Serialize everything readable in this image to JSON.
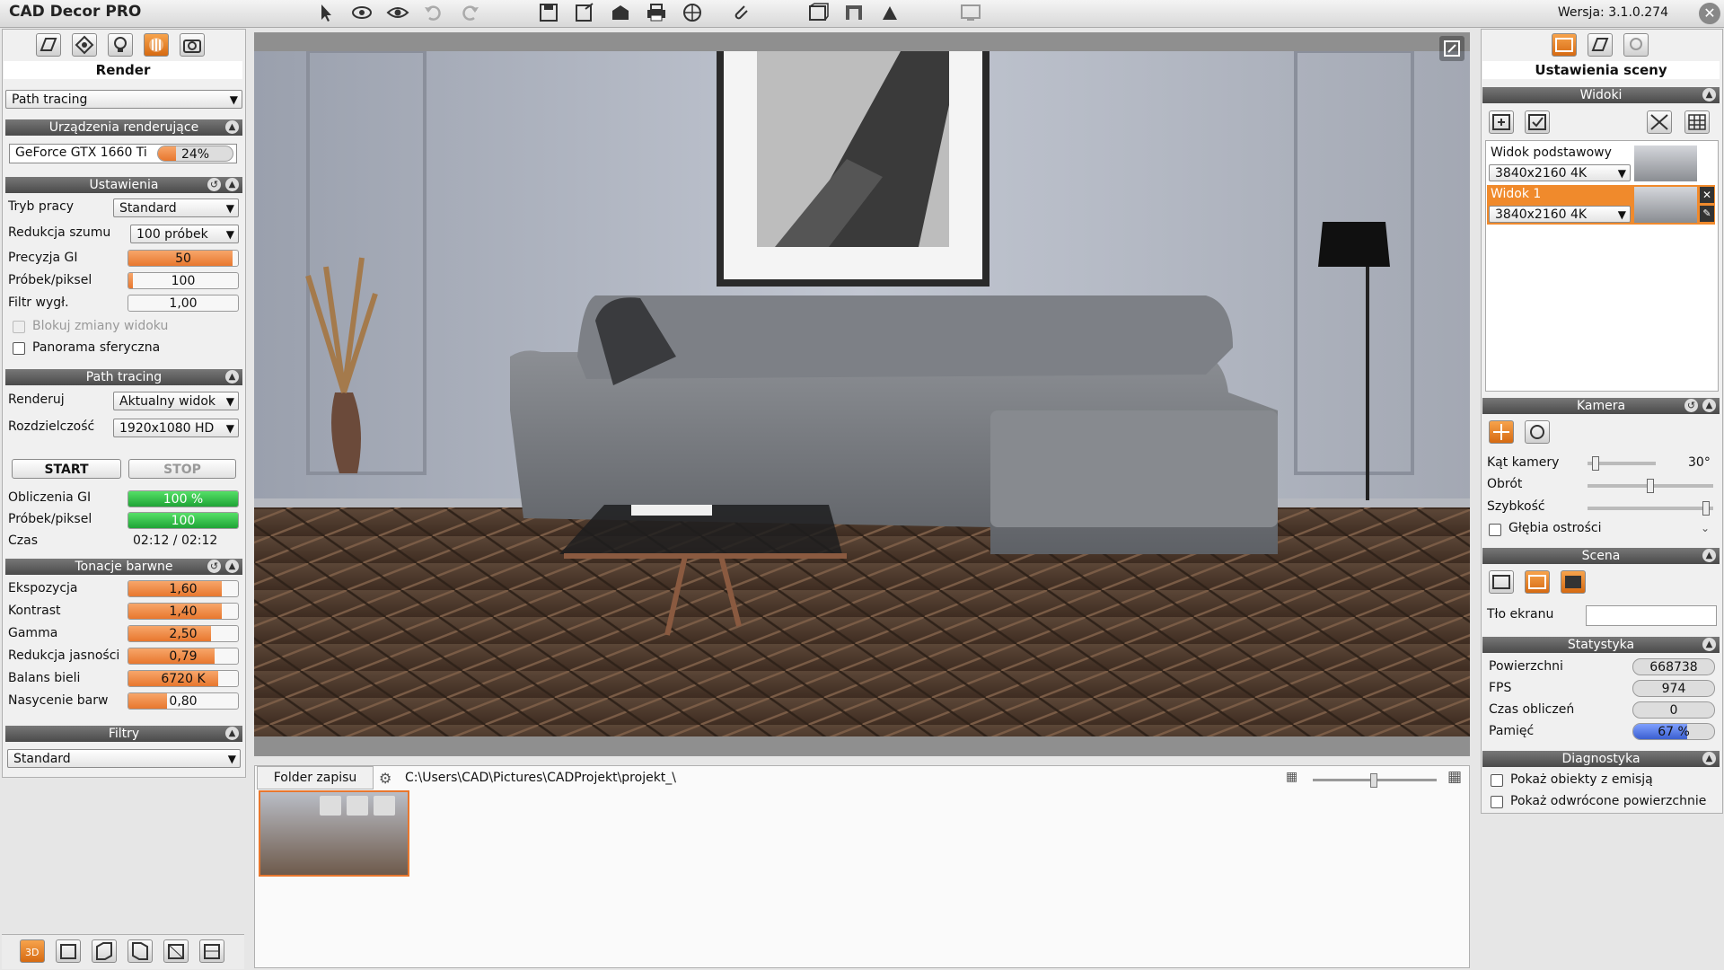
{
  "app": {
    "title": "CAD Decor PRO",
    "version": "Wersja: 3.1.0.274"
  },
  "left": {
    "header": "Render",
    "mode_select": "Path tracing",
    "devices": {
      "title": "Urządzenia renderujące",
      "gpu": "GeForce GTX 1660 Ti",
      "gpu_load": "24%",
      "gpu_load_value": 0.24
    },
    "settings": {
      "title": "Ustawienia",
      "work_mode_label": "Tryb pracy",
      "work_mode": "Standard",
      "denoise_label": "Redukcja szumu",
      "denoise": "100 próbek",
      "gi_label": "Precyzja GI",
      "gi": "50",
      "gi_fill": 0.95,
      "spp_label": "Próbek/piksel",
      "spp": "100",
      "spp_fill": 0.04,
      "filter_label": "Filtr wygł.",
      "filter": "1,00",
      "lock_label": "Blokuj zmiany widoku",
      "panorama_label": "Panorama sferyczna"
    },
    "pathtracing": {
      "title": "Path tracing",
      "render_label": "Renderuj",
      "render": "Aktualny widok",
      "res_label": "Rozdzielczość",
      "res": "1920x1080 HD",
      "start": "START",
      "stop": "STOP",
      "gi_calc_label": "Obliczenia GI",
      "gi_calc": "100 %",
      "spp_label": "Próbek/piksel",
      "spp": "100",
      "time_label": "Czas",
      "time": "02:12 / 02:12"
    },
    "tone": {
      "title": "Tonacje barwne",
      "items": [
        {
          "label": "Ekspozycja",
          "value": "1,60",
          "fill": 0.85
        },
        {
          "label": "Kontrast",
          "value": "1,40",
          "fill": 0.85
        },
        {
          "label": "Gamma",
          "value": "2,50",
          "fill": 0.75
        },
        {
          "label": "Redukcja jasności",
          "value": "0,79",
          "fill": 0.79
        },
        {
          "label": "Balans bieli",
          "value": "6720 K",
          "fill": 0.82
        },
        {
          "label": "Nasycenie barw",
          "value": "0,80",
          "fill": 0.35
        }
      ]
    },
    "filters": {
      "title": "Filtry",
      "value": "Standard"
    }
  },
  "bottom": {
    "folder_tab": "Folder zapisu",
    "path": "C:\\Users\\CAD\\Pictures\\CADProjekt\\projekt_\\"
  },
  "right": {
    "header": "Ustawienia sceny",
    "views": {
      "title": "Widoki",
      "items": [
        {
          "name": "Widok podstawowy",
          "res": "3840x2160 4K"
        },
        {
          "name": "Widok 1",
          "res": "3840x2160 4K"
        }
      ]
    },
    "camera": {
      "title": "Kamera",
      "angle_label": "Kąt kamery",
      "angle": "30°",
      "angle_level": 0.08,
      "rotation_label": "Obrót",
      "rotation_level": 0.5,
      "speed_label": "Szybkość",
      "speed_level": 0.97,
      "dof_label": "Głębia ostrości"
    },
    "scene": {
      "title": "Scena",
      "bg_label": "Tło ekranu"
    },
    "stats": {
      "title": "Statystyka",
      "surfaces_label": "Powierzchni",
      "surfaces": "668738",
      "fps_label": "FPS",
      "fps": "974",
      "calc_label": "Czas obliczeń",
      "calc": "0",
      "mem_label": "Pamięć",
      "mem": "67 %",
      "mem_value": 0.67
    },
    "diag": {
      "title": "Diagnostyka",
      "emit_label": "Pokaż obiekty z emisją",
      "inverted_label": "Pokaż odwrócone powierzchnie"
    }
  },
  "colors": {
    "accent": "#e8772e",
    "header": "#555555",
    "progress": "#2fbf45",
    "memory": "#4a6fd8"
  }
}
